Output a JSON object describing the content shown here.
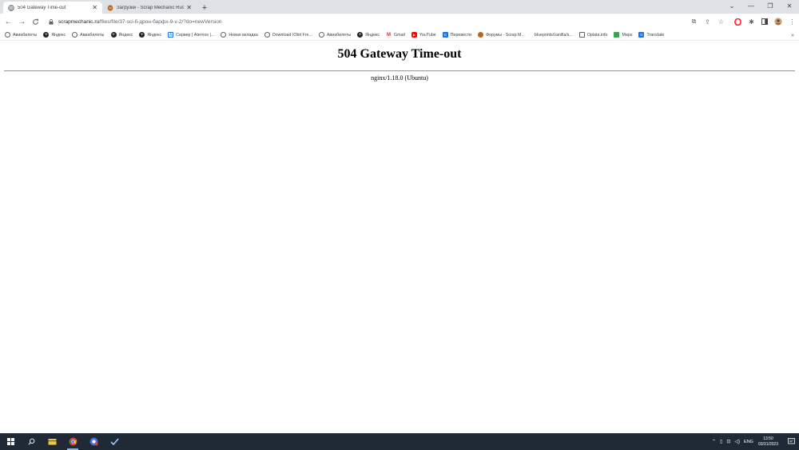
{
  "tabs": [
    {
      "title": "504 Gateway Time-out",
      "active": true
    },
    {
      "title": "Загрузки - Scrap Mechanic Russ",
      "active": false
    }
  ],
  "new_tab_glyph": "+",
  "window_controls": {
    "dropdown": "⌄",
    "minimize": "—",
    "restore": "❐",
    "close": "✕"
  },
  "toolbar": {
    "back": "←",
    "forward": "→",
    "reload": "C",
    "url_host": "scrapmechanic.ru",
    "url_path": "/files/file/37-sci-fi-дрон-барфх-9-v-2/?do=newVersion"
  },
  "bookmarks": [
    {
      "label": "Авиабилеты",
      "icon": "globe-icon",
      "color": "#5f6368"
    },
    {
      "label": "Яндекс",
      "icon": "plus-circle-icon",
      "color": "#202124"
    },
    {
      "label": "Авиабилеты",
      "icon": "globe-icon",
      "color": "#5f6368"
    },
    {
      "label": "Яндекс",
      "icon": "plus-circle-icon",
      "color": "#202124"
    },
    {
      "label": "Яндекс",
      "icon": "plus-circle-icon",
      "color": "#202124"
    },
    {
      "label": "Сервер | Aternos |...",
      "icon": "aternos-icon",
      "color": "#1a73e8"
    },
    {
      "label": "Новая вкладка",
      "icon": "globe-icon",
      "color": "#5f6368"
    },
    {
      "label": "Download IObit Fre...",
      "icon": "globe-icon",
      "color": "#5f6368"
    },
    {
      "label": "Авиабилеты",
      "icon": "globe-icon",
      "color": "#5f6368"
    },
    {
      "label": "Яндекс",
      "icon": "plus-circle-icon",
      "color": "#202124"
    },
    {
      "label": "Gmail",
      "icon": "gmail-icon",
      "color": "#d93025"
    },
    {
      "label": "YouTube",
      "icon": "youtube-icon",
      "color": "#ff0000"
    },
    {
      "label": "Перевести",
      "icon": "translate-icon",
      "color": "#1a73e8"
    },
    {
      "label": "Форумы - Scrap M...",
      "icon": "scrap-mechanic-icon",
      "color": "#b5651d"
    },
    {
      "label": "blueprints/vanilla/s...",
      "icon": "none",
      "color": "#ffffff"
    },
    {
      "label": "Oplata.info",
      "icon": "folder-icon",
      "color": "#5f6368"
    },
    {
      "label": "Maps",
      "icon": "maps-icon",
      "color": "#34a853"
    },
    {
      "label": "Translate",
      "icon": "translate-icon",
      "color": "#1a73e8"
    }
  ],
  "bookmarks_more": "»",
  "page": {
    "heading": "504 Gateway Time-out",
    "server": "nginx/1.18.0 (Ubuntu)"
  },
  "taskbar": {
    "language": "ENG",
    "time": "13:50",
    "date": "03/31/2023"
  }
}
